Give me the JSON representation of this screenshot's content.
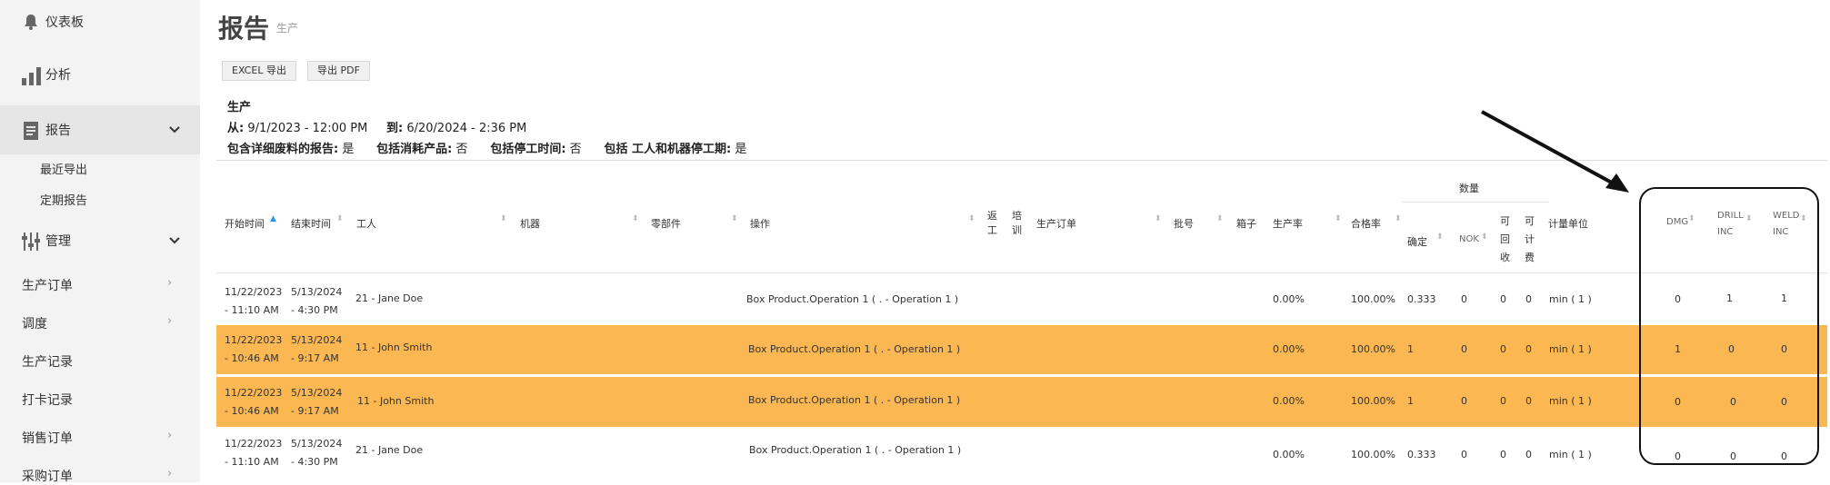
{
  "sidebar": {
    "items": [
      {
        "label": "仪表板",
        "icon": "bell-icon"
      },
      {
        "label": "分析",
        "icon": "bar-chart-icon"
      },
      {
        "label": "报告",
        "icon": "report-icon",
        "expanded": true
      },
      {
        "label": "管理",
        "icon": "sliders-icon",
        "expanded": false
      }
    ],
    "report_sub": [
      "最近导出",
      "定期报告"
    ],
    "plain": [
      "生产订单",
      "调度",
      "生产记录",
      "打卡记录",
      "销售订单",
      "采购订单"
    ]
  },
  "page": {
    "title": "报告",
    "subtitle": "生产",
    "excel_btn": "EXCEL 导出",
    "pdf_btn": "导出 PDF",
    "section": "生产",
    "from_label": "从:",
    "from_value": "9/1/2023 - 12:00 PM",
    "to_label": "到:",
    "to_value": "6/20/2024 - 2:36 PM",
    "opt1_label": "包含详细废料的报告:",
    "opt1_value": "是",
    "opt2_label": "包括消耗产品:",
    "opt2_value": "否",
    "opt3_label": "包括停工时间:",
    "opt3_value": "否",
    "opt4_label": "包括 工人和机器停工期:",
    "opt4_value": "是"
  },
  "table": {
    "group_header": "数量",
    "headers": {
      "start": "开始时间",
      "end": "结束时间",
      "worker": "工人",
      "machine": "机器",
      "part": "零部件",
      "operation": "操作",
      "rework1": "返",
      "rework2": "工",
      "train1": "培",
      "train2": "训",
      "order": "生产订单",
      "batch": "批号",
      "box": "箱子",
      "rate": "生产率",
      "pass": "合格率",
      "ok": "确定",
      "nok": "NOK",
      "recyc1": "可",
      "recyc2": "回",
      "recyc3": "收",
      "bill1": "可",
      "bill2": "计",
      "bill3": "费",
      "unit": "计量单位",
      "dmg": "DMG",
      "drill1": "DRILL",
      "drill2": "INC",
      "weld1": "WELD",
      "weld2": "INC"
    },
    "rows": [
      {
        "start1": "11/22/2023",
        "start2": "- 11:10 AM",
        "end1": "5/13/2024",
        "end2": "- 4:30 PM",
        "worker": "21 - Jane Doe",
        "operation": "Box Product.Operation 1 ( . - Operation 1 )",
        "rate": "0.00%",
        "pass": "100.00%",
        "ok": "0.333",
        "nok": "0",
        "recyc": "0",
        "bill": "0",
        "unit": "min ( 1 )",
        "dmg": "0",
        "drill": "1",
        "weld": "1",
        "highlight": false
      },
      {
        "start1": "11/22/2023",
        "start2": "- 10:46 AM",
        "end1": "5/13/2024",
        "end2": "- 9:17 AM",
        "worker": "11 - John Smith",
        "operation": "Box Product.Operation 1 ( . - Operation 1 )",
        "rate": "0.00%",
        "pass": "100.00%",
        "ok": "1",
        "nok": "0",
        "recyc": "0",
        "bill": "0",
        "unit": "min ( 1 )",
        "dmg": "1",
        "drill": "0",
        "weld": "0",
        "highlight": true
      },
      {
        "start1": "11/22/2023",
        "start2": "- 10:46 AM",
        "end1": "5/13/2024",
        "end2": "- 9:17 AM",
        "worker": "11 - John Smith",
        "operation": "Box Product.Operation 1 ( . - Operation 1 )",
        "rate": "0.00%",
        "pass": "100.00%",
        "ok": "1",
        "nok": "0",
        "recyc": "0",
        "bill": "0",
        "unit": "min ( 1 )",
        "dmg": "0",
        "drill": "0",
        "weld": "0",
        "highlight": true
      },
      {
        "start1": "11/22/2023",
        "start2": "- 11:10 AM",
        "end1": "5/13/2024",
        "end2": "- 4:30 PM",
        "worker": "21 - Jane Doe",
        "operation": "Box Product.Operation 1 ( . - Operation 1 )",
        "rate": "0.00%",
        "pass": "100.00%",
        "ok": "0.333",
        "nok": "0",
        "recyc": "0",
        "bill": "0",
        "unit": "min ( 1 )",
        "dmg": "0",
        "drill": "0",
        "weld": "0",
        "highlight": false
      }
    ]
  },
  "colors": {
    "highlight_row": "#fbb752",
    "sidebar_bg": "#f3f3f3",
    "sort_active": "#2196f3"
  }
}
